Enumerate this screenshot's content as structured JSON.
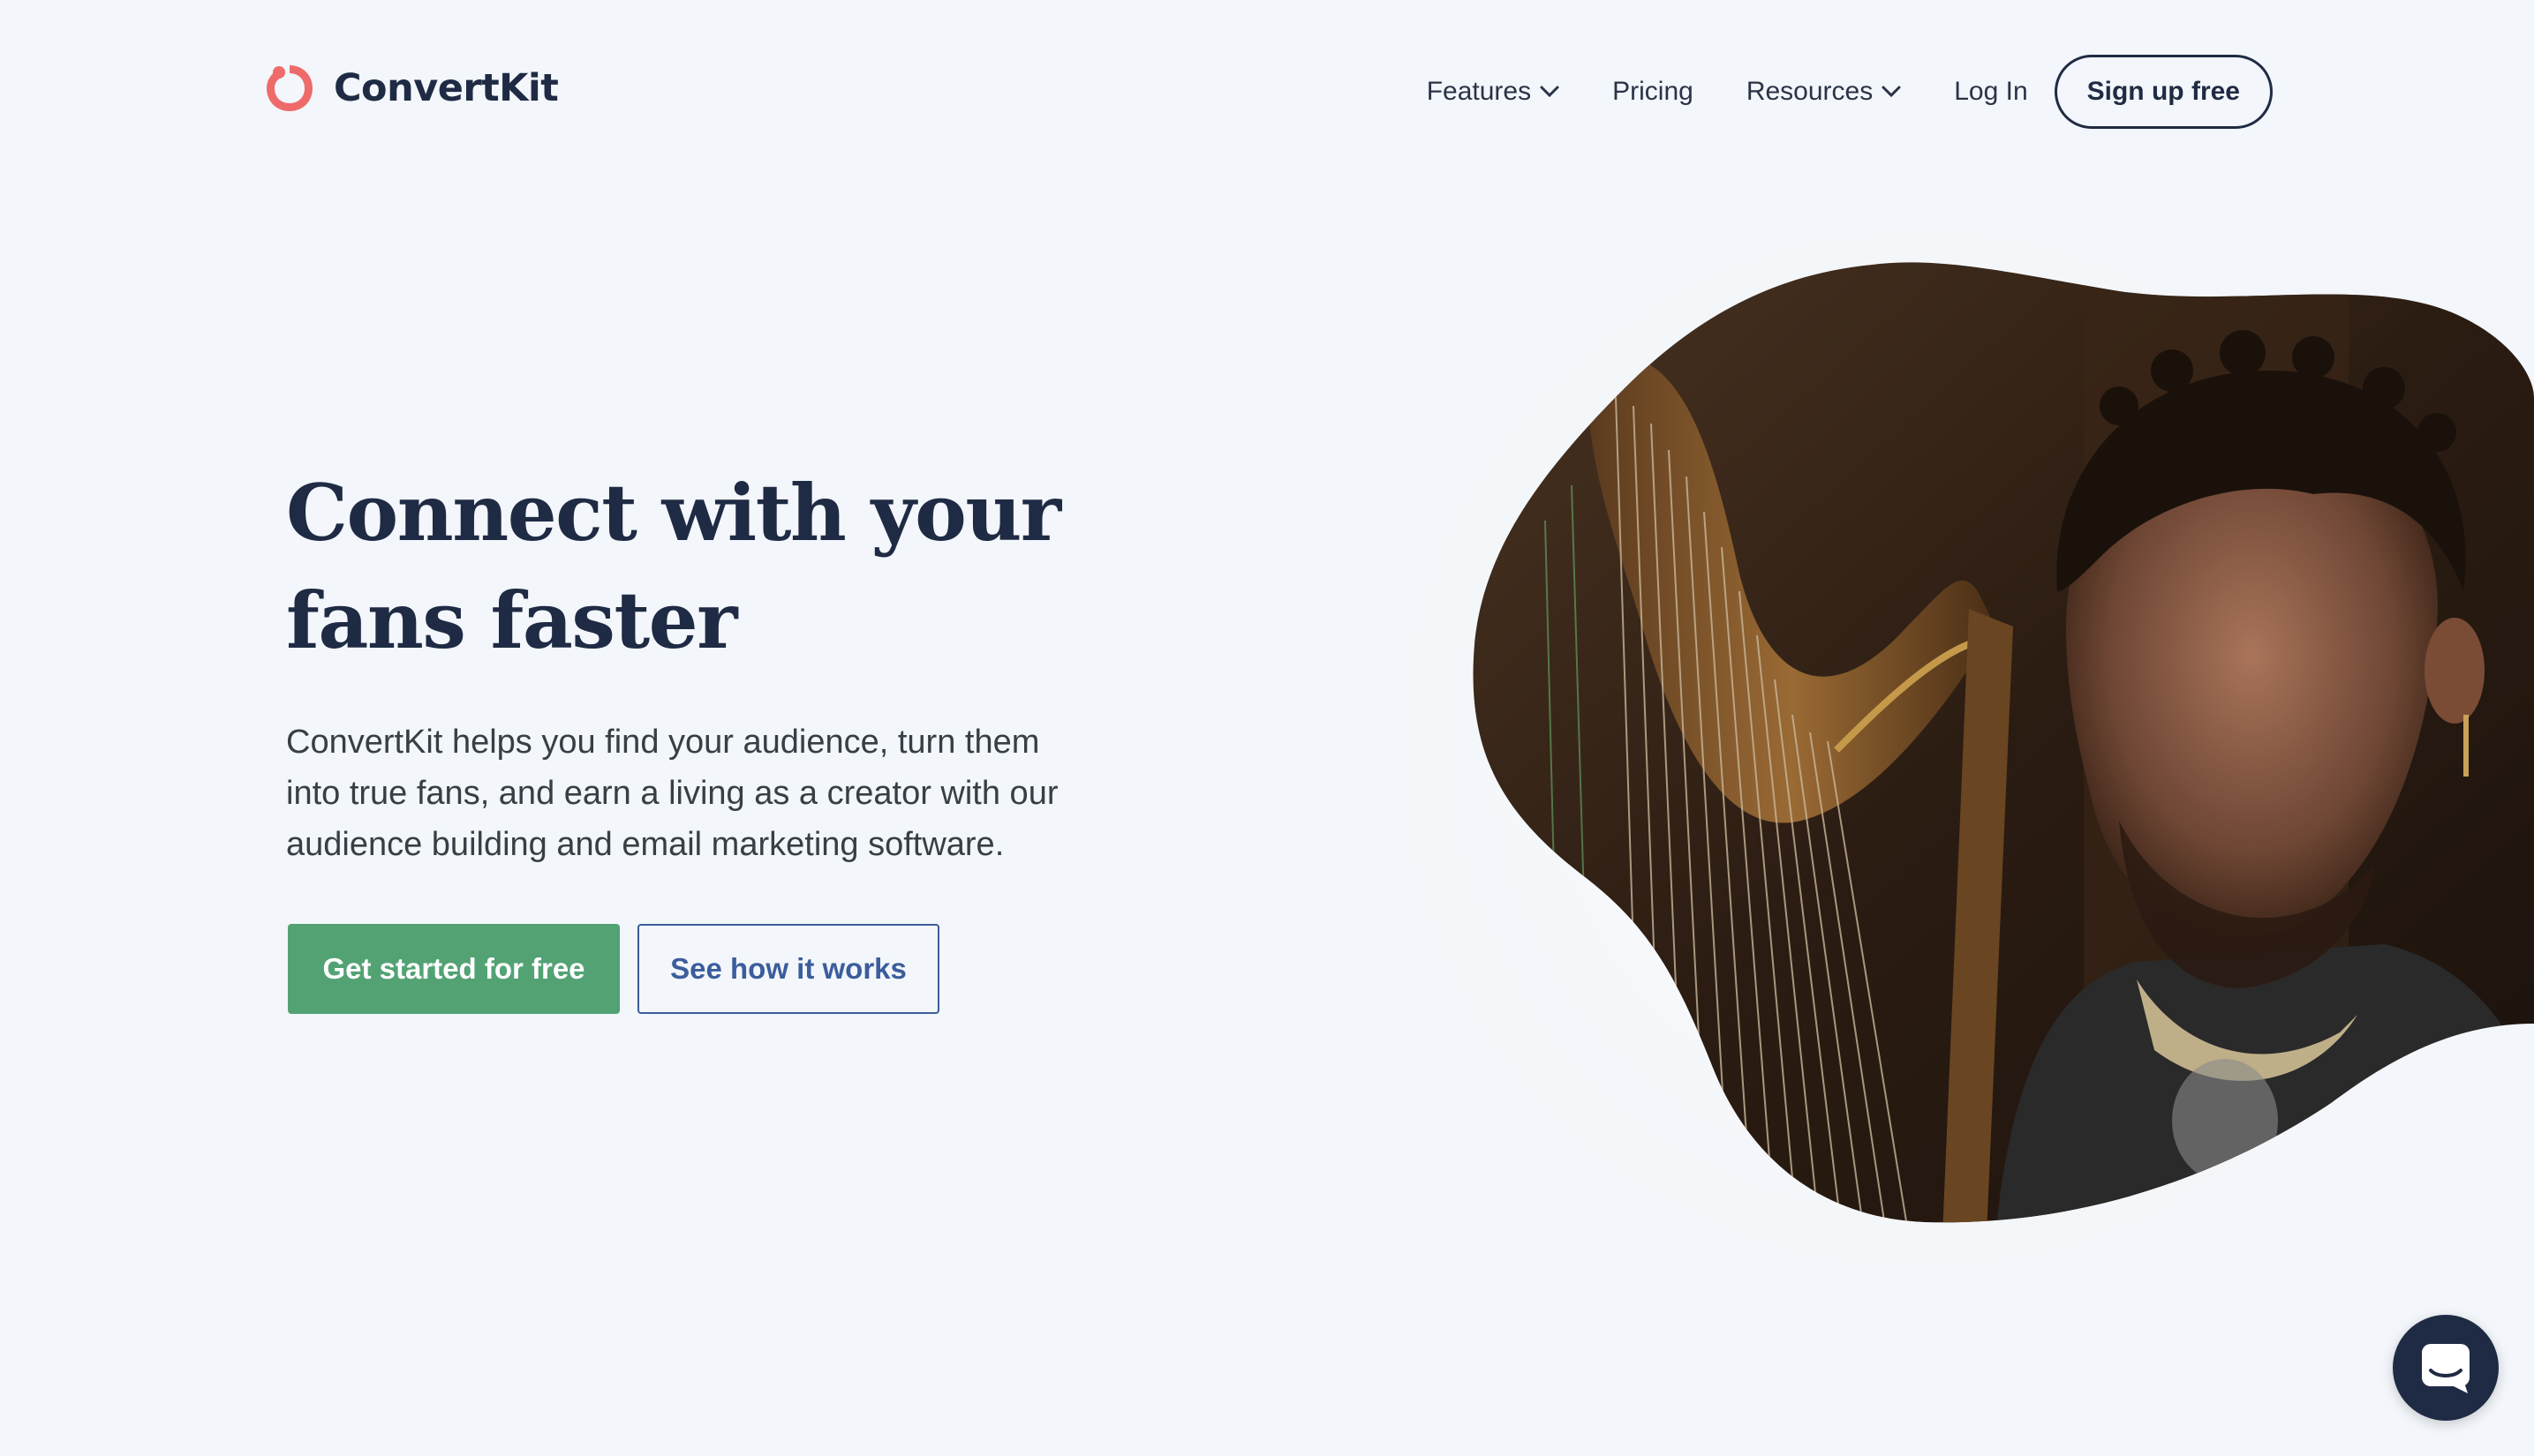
{
  "header": {
    "brand_name": "ConvertKit",
    "logo_icon": "convertkit-logo-icon",
    "nav": [
      {
        "label": "Features",
        "has_dropdown": true
      },
      {
        "label": "Pricing",
        "has_dropdown": false
      },
      {
        "label": "Resources",
        "has_dropdown": true
      },
      {
        "label": "Log In",
        "has_dropdown": false
      }
    ],
    "signup_label": "Sign up free"
  },
  "hero": {
    "title": "Connect with your fans faster",
    "body": "ConvertKit helps you find your audience, turn them into true fans, and earn a living as a creator with our audience building and email marketing software.",
    "primary_cta": "Get started for free",
    "secondary_cta": "See how it works",
    "image": "harpist-photo"
  },
  "chat": {
    "icon": "chat-bubble-icon"
  },
  "colors": {
    "background": "#f3f6fa",
    "brand_red": "#ef6b6b",
    "navy": "#1f2b44",
    "primary_green": "#52a274",
    "secondary_blue": "#3b5d9c"
  }
}
